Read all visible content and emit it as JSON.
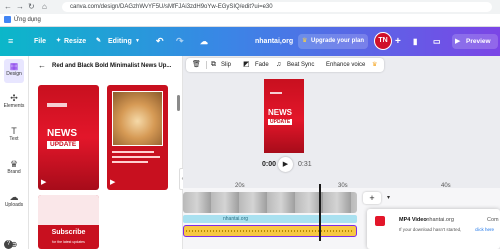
{
  "browser": {
    "url": "canva.com/design/DAGzhWvYF5U/sMfFJAi3zdH9oYw-EGySIQ/edit?ui=e30",
    "bookmark": "Ứng dụng"
  },
  "header": {
    "file_label": "File",
    "resize_label": "Resize",
    "editing_label": "Editing",
    "user_name": "nhantai,org",
    "upgrade_label": "Upgrade your plan",
    "avatar_initials": "TN",
    "preview_label": "Preview"
  },
  "rail": {
    "items": [
      {
        "label": "Design",
        "icon": "design-icon"
      },
      {
        "label": "Elements",
        "icon": "elements-icon"
      },
      {
        "label": "Text",
        "icon": "text-icon"
      },
      {
        "label": "Brand",
        "icon": "brand-icon"
      },
      {
        "label": "Uploads",
        "icon": "uploads-icon"
      }
    ]
  },
  "panel": {
    "title": "Red and Black Bold Minimalist News Up...",
    "news_word": "NEWS",
    "update_word": "UPDATE",
    "subscribe_label": "Subscribe",
    "subscribe_sub": "for the latest updates"
  },
  "context_bar": {
    "slip": "Slip",
    "fade": "Fade",
    "beat_sync": "Beat Sync",
    "enhance_voice": "Enhance voice"
  },
  "canvas": {
    "news_word": "NEWS",
    "update_word": "UPDATE",
    "time_current": "0:00",
    "time_total": "0:31"
  },
  "timeline": {
    "marks": [
      "20s",
      "30s",
      "40s"
    ],
    "audio_caption": "nhantai.org"
  },
  "toast": {
    "title": "MP4 Video",
    "source": "· nhantai.org",
    "message": "If your download hasn't started,",
    "link": "click here",
    "extra": "Com"
  },
  "colors": {
    "accent_red": "#e3162a",
    "header_start": "#0bb7c9",
    "header_end": "#7b45e6",
    "avatar": "#d0102a"
  }
}
